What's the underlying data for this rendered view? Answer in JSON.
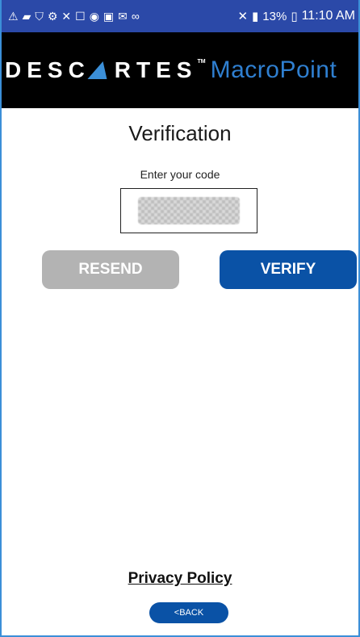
{
  "status_bar": {
    "left_icons": [
      "warning-icon",
      "message-icon",
      "wifi-icon",
      "hotspot-icon",
      "usb-icon",
      "calendar-icon",
      "app-icon",
      "image-icon",
      "mail-icon",
      "voicemail-icon"
    ],
    "left_glyphs": [
      "⚠",
      "▰",
      "⛉",
      "⚙",
      "✕",
      "☐",
      "◉",
      "▣",
      "✉",
      "∞"
    ],
    "mute_glyph": "✕",
    "signal_glyph": "▮",
    "battery_percent": "13%",
    "battery_glyph": "▯",
    "time": "11:10 AM"
  },
  "header": {
    "brand_part1": "DESC",
    "brand_part2": "RTES",
    "trademark": "TM",
    "product": "MacroPoint"
  },
  "verification": {
    "title": "Verification",
    "code_label": "Enter your code"
  },
  "actions": {
    "resend_label": "RESEND",
    "verify_label": "VERIFY"
  },
  "footer": {
    "privacy_label": "Privacy Policy",
    "back_label": "<BACK"
  },
  "colors": {
    "status_bar": "#2b49a8",
    "header": "#000000",
    "accent_blue": "#0a52a6",
    "logo_blue": "#2f7fd0",
    "resend_disabled": "#b3b3b3"
  }
}
